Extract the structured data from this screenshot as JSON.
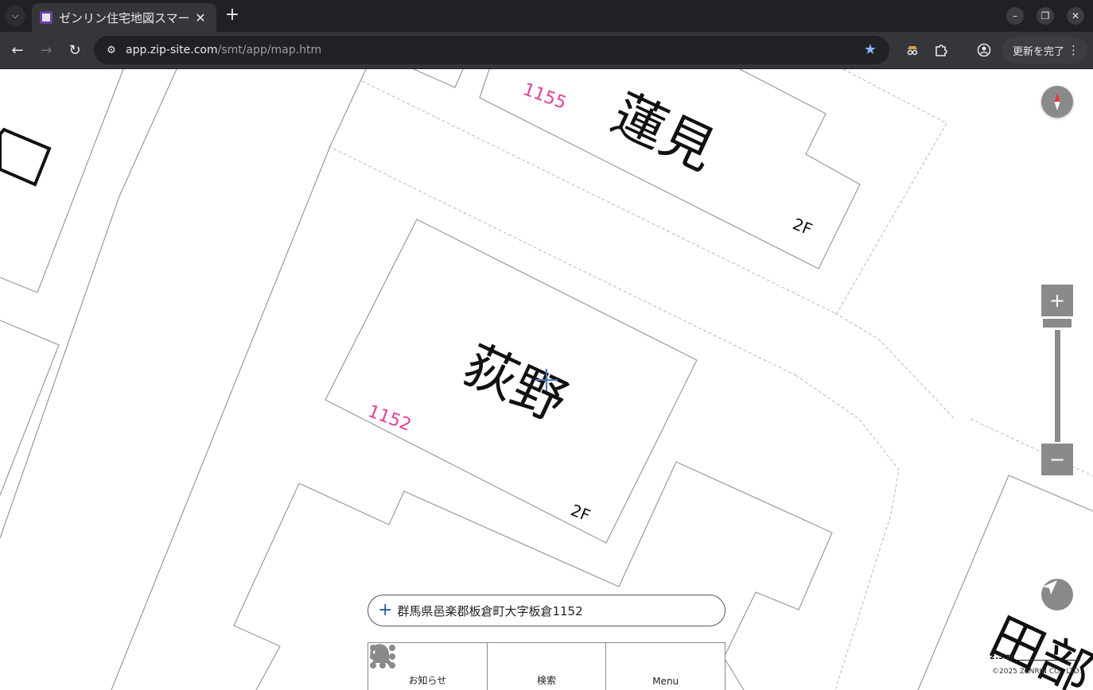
{
  "browser": {
    "tab_title": "ゼンリン住宅地図スマー",
    "tab_close": "✕",
    "new_tab": "+",
    "url_host": "app.zip-site.com",
    "url_path": "/smt/app/map.htm",
    "update_button": "更新を完了"
  },
  "map": {
    "labels": [
      {
        "text": "蓮見",
        "kind": "name"
      },
      {
        "text": "荻野",
        "kind": "name"
      },
      {
        "text": "田部",
        "kind": "name"
      },
      {
        "text": "1155",
        "kind": "lot"
      },
      {
        "text": "1152",
        "kind": "lot"
      },
      {
        "text": "2F",
        "kind": "floors"
      },
      {
        "text": "2F",
        "kind": "floors"
      }
    ],
    "zoom_in": "+",
    "zoom_out": "−",
    "scale_label": "2.5 m",
    "copyright": "©2025 ZENRIN CO., LTD."
  },
  "address_bar": {
    "text": "群馬県邑楽郡板倉町大字板倉1152"
  },
  "bottom_menu": {
    "items": [
      {
        "label": "お知らせ",
        "icon": "bell-icon"
      },
      {
        "label": "検索",
        "icon": "search-icon"
      },
      {
        "label": "Menu",
        "icon": "grid-icon"
      }
    ]
  },
  "colors": {
    "control_gray": "#8a8a8a",
    "lot_pink": "#e0409a",
    "browser_dark": "#202124"
  }
}
